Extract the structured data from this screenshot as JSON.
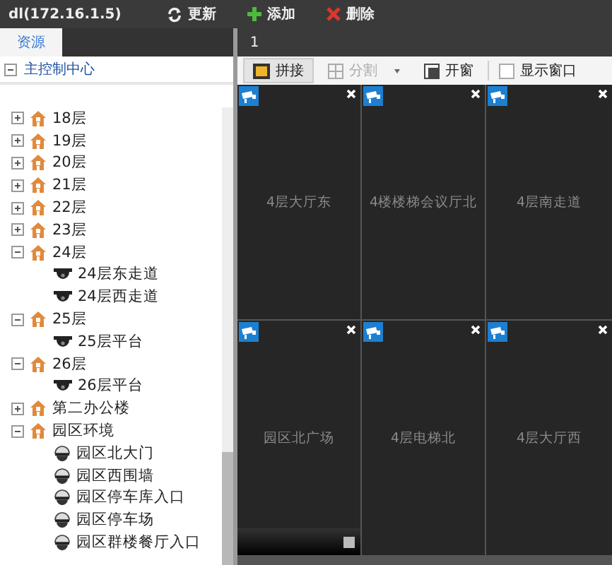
{
  "title_bar": {
    "title": "dl(172.16.1.5)",
    "actions": [
      {
        "kind": "refresh",
        "label": "更新"
      },
      {
        "kind": "add",
        "label": "添加"
      },
      {
        "kind": "delete",
        "label": "删除"
      }
    ]
  },
  "sidebar": {
    "tabs": [
      {
        "label": "资源",
        "selected": true
      }
    ],
    "root": {
      "label": "主控制中心",
      "expanded": true
    },
    "tree": [
      {
        "children": [
          {
            "kind": "building",
            "label": "18层",
            "expanded": false
          },
          {
            "kind": "building",
            "label": "19层",
            "expanded": false
          },
          {
            "kind": "building",
            "label": "20层",
            "expanded": false
          },
          {
            "kind": "building",
            "label": "21层",
            "expanded": false
          },
          {
            "kind": "building",
            "label": "22层",
            "expanded": false
          },
          {
            "kind": "building",
            "label": "23层",
            "expanded": false
          },
          {
            "kind": "building",
            "label": "24层",
            "expanded": true,
            "children": [
              {
                "kind": "dome",
                "label": "24层东走道"
              },
              {
                "kind": "dome",
                "label": "24层西走道"
              }
            ]
          },
          {
            "kind": "building",
            "label": "25层",
            "expanded": true,
            "children": [
              {
                "kind": "dome",
                "label": "25层平台"
              }
            ]
          },
          {
            "kind": "building",
            "label": "26层",
            "expanded": true,
            "children": [
              {
                "kind": "dome",
                "label": "26层平台"
              }
            ]
          }
        ]
      },
      {
        "kind": "building",
        "label": "第二办公楼",
        "expanded": false
      },
      {
        "kind": "building",
        "label": "园区环境",
        "expanded": true,
        "children": [
          {
            "kind": "ball",
            "label": "园区北大门"
          },
          {
            "kind": "ball",
            "label": "园区西围墙"
          },
          {
            "kind": "ball",
            "label": "园区停车库入口"
          },
          {
            "kind": "ball",
            "label": "园区停车场"
          },
          {
            "kind": "ball",
            "label": "园区群楼餐厅入口"
          }
        ]
      }
    ]
  },
  "main": {
    "tabs": [
      {
        "label": "1",
        "selected": true
      }
    ],
    "toolbar": [
      {
        "kind": "splice",
        "label": "拼接",
        "selected": true,
        "disabled": false
      },
      {
        "kind": "split",
        "label": "分割",
        "selected": false,
        "disabled": true
      },
      {
        "kind": "window",
        "label": "开窗",
        "selected": false,
        "disabled": false
      },
      {
        "kind": "checkbox",
        "label": "显示窗口",
        "checked": false
      }
    ],
    "cells": [
      {
        "label": "4层大厅东",
        "controls_visible": false
      },
      {
        "label": "4楼楼梯会议厅北",
        "controls_visible": false
      },
      {
        "label": "4层南走道",
        "controls_visible": false
      },
      {
        "label": "园区北广场",
        "controls_visible": true
      },
      {
        "label": "4层电梯北",
        "controls_visible": false
      },
      {
        "label": "4层大厅西",
        "controls_visible": false
      }
    ]
  }
}
